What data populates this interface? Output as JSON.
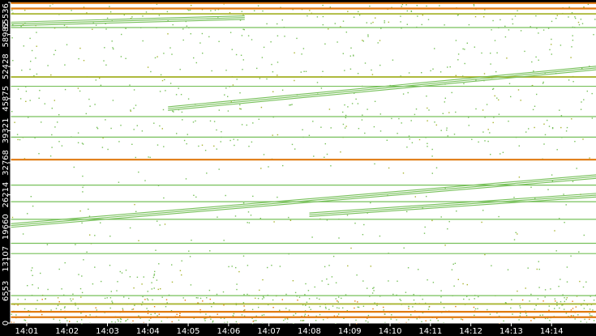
{
  "chart_data": {
    "type": "scatter",
    "title": "",
    "xlabel": "",
    "ylabel": "",
    "x_ticks": [
      "14:01",
      "14:02",
      "14:03",
      "14:04",
      "14:05",
      "14:06",
      "14:07",
      "14:08",
      "14:09",
      "14:10",
      "14:11",
      "14:12",
      "14:13",
      "14:14"
    ],
    "xlim_minutes": [
      14.6,
      29.1
    ],
    "y_ticks": [
      0,
      6553,
      13107,
      19660,
      26214,
      32768,
      39321,
      45875,
      52428,
      58982,
      65536
    ],
    "ylim": [
      0,
      65536
    ],
    "grid": false,
    "legend": "none",
    "colors": {
      "background": "#000000",
      "plot_background": "#ffffff",
      "point_low": "#77c05a",
      "point_mid": "#a8b530",
      "point_high": "#e07a10",
      "axis_text": "#ffffff",
      "axis_line": "#ffffff"
    },
    "horizontal_bands": [
      {
        "y": 65400,
        "intensity": "high"
      },
      {
        "y": 64300,
        "intensity": "high"
      },
      {
        "y": 63200,
        "intensity": "mid"
      },
      {
        "y": 60400,
        "intensity": "low"
      },
      {
        "y": 50300,
        "intensity": "mid"
      },
      {
        "y": 48400,
        "intensity": "low"
      },
      {
        "y": 42200,
        "intensity": "low"
      },
      {
        "y": 38000,
        "intensity": "low"
      },
      {
        "y": 33400,
        "intensity": "high"
      },
      {
        "y": 28200,
        "intensity": "low"
      },
      {
        "y": 24800,
        "intensity": "low"
      },
      {
        "y": 21200,
        "intensity": "low"
      },
      {
        "y": 16300,
        "intensity": "low"
      },
      {
        "y": 14200,
        "intensity": "low"
      },
      {
        "y": 5600,
        "intensity": "low"
      },
      {
        "y": 3900,
        "intensity": "mid"
      },
      {
        "y": 2300,
        "intensity": "high"
      },
      {
        "y": 1200,
        "intensity": "high"
      }
    ],
    "diagonal_trends": [
      {
        "x1": 14.6,
        "y1": 61500,
        "x2": 20.4,
        "y2": 62800
      },
      {
        "x1": 18.5,
        "y1": 44200,
        "x2": 29.1,
        "y2": 52500
      },
      {
        "x1": 14.6,
        "y1": 20300,
        "x2": 29.1,
        "y2": 30300
      },
      {
        "x1": 22.0,
        "y1": 22500,
        "x2": 29.1,
        "y2": 26500
      }
    ]
  }
}
